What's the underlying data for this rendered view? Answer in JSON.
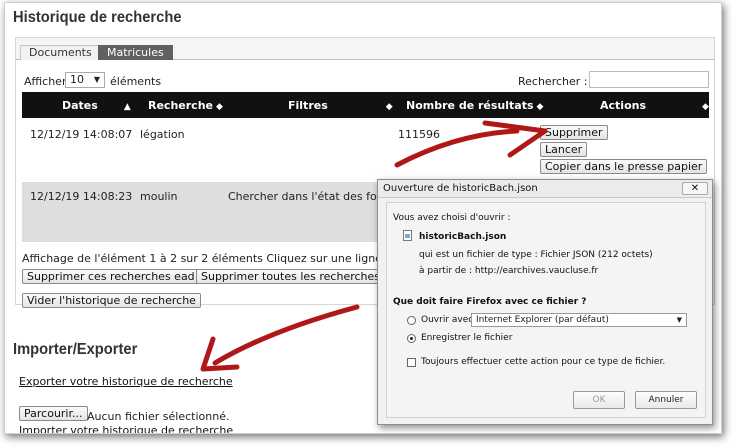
{
  "page": {
    "title": "Historique de recherche",
    "tabs": [
      {
        "label": "Documents"
      },
      {
        "label": "Matricules"
      }
    ]
  },
  "table_controls": {
    "show_label": "Afficher",
    "show_value": "10",
    "show_after": "éléments",
    "search_label": "Rechercher :"
  },
  "table": {
    "headers": [
      "Dates",
      "Recherche",
      "Filtres",
      "Nombre de résultats",
      "Actions"
    ],
    "rows": [
      {
        "date": "12/12/19 14:08:07",
        "search": "légation",
        "filters": "",
        "results": "111596"
      },
      {
        "date": "12/12/19 14:08:23",
        "search": "moulin",
        "filters": "Chercher dans l'état des fonds",
        "results": ""
      }
    ],
    "actions": {
      "delete": "Supprimer",
      "launch": "Lancer",
      "copy": "Copier dans le presse papier"
    },
    "info": "Affichage de l'élément 1 à 2 sur 2 éléments   Cliquez sur une ligne pour"
  },
  "buttons": {
    "delete_ead": "Supprimer ces recherches ead",
    "delete_all": "Supprimer toutes les recherches en",
    "clear_history": "Vider l'historique de recherche"
  },
  "import_export": {
    "title": "Importer/Exporter",
    "export_link": "Exporter votre historique de recherche",
    "browse_button": "Parcourir...",
    "file_status": "Aucun fichier sélectionné.",
    "import_link": "Importer votre historique de recherche"
  },
  "dialog": {
    "title": "Ouverture de historicBach.json",
    "close": "✕",
    "chosen_label": "Vous avez choisi d'ouvrir :",
    "filename": "historicBach.json",
    "filetype": "qui est un fichier de type : Fichier JSON (212 octets)",
    "from": "à partir de : http://earchives.vaucluse.fr",
    "question": "Que doit faire Firefox avec ce fichier ?",
    "open_with_label": "Ouvrir avec",
    "open_with_app": "Internet Explorer (par défaut)",
    "save_label": "Enregistrer le fichier",
    "always_label": "Toujours effectuer cette action pour ce type de fichier.",
    "ok": "OK",
    "cancel": "Annuler"
  },
  "colors": {
    "annotation_arrow": "#b01818",
    "table_header": "#111111",
    "active_tab": "#606060"
  }
}
